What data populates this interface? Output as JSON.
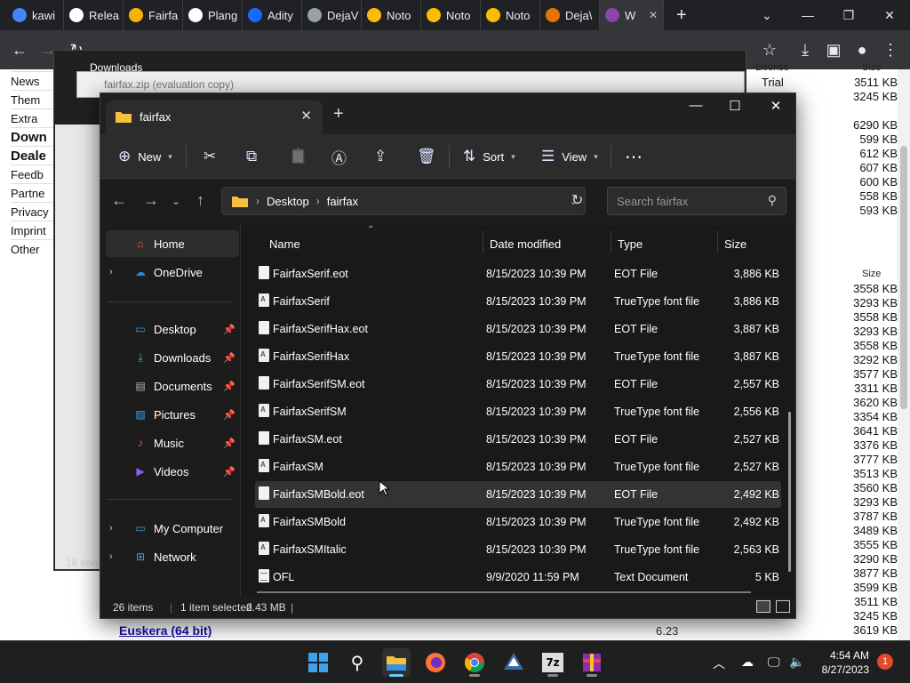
{
  "chrome": {
    "tabs": [
      {
        "label": "kawi",
        "icon": "google-icon",
        "color": "#4285f4"
      },
      {
        "label": "Relea",
        "icon": "github-icon",
        "color": "#ffffff"
      },
      {
        "label": "Fairfa",
        "icon": "font-site-icon",
        "color": "#f4b400"
      },
      {
        "label": "Plang",
        "icon": "github-icon",
        "color": "#ffffff"
      },
      {
        "label": "Adity",
        "icon": "behance-icon",
        "color": "#1769ff"
      },
      {
        "label": "DejaV",
        "icon": "globe-icon",
        "color": "#9aa0a6"
      },
      {
        "label": "Noto",
        "icon": "noto-icon",
        "color": "#fbbc04"
      },
      {
        "label": "Noto",
        "icon": "noto-icon",
        "color": "#fbbc04"
      },
      {
        "label": "Noto",
        "icon": "noto-icon",
        "color": "#fbbc04"
      },
      {
        "label": "Deja\\",
        "icon": "diamond-icon",
        "color": "#e37400"
      },
      {
        "label": "W",
        "icon": "winrar-icon",
        "color": "#8e44ad"
      }
    ]
  },
  "webpage": {
    "side_links": [
      {
        "label": "News",
        "bold": false
      },
      {
        "label": "Them",
        "bold": false
      },
      {
        "label": "Extra",
        "bold": false
      },
      {
        "label": "Down",
        "bold": true
      },
      {
        "label": "Deale",
        "bold": true
      },
      {
        "label": "Feedb",
        "bold": false
      },
      {
        "label": "Partne",
        "bold": false
      },
      {
        "label": "Privacy",
        "bold": false
      },
      {
        "label": "Imprint",
        "bold": false
      },
      {
        "label": "Other",
        "bold": false
      }
    ],
    "license_header": "License",
    "size_header": "Size",
    "top_rows": [
      {
        "license": "Trial",
        "size": "3511 KB"
      },
      {
        "license": "",
        "size": "3245 KB"
      },
      {
        "license": "",
        "size": "6290 KB"
      },
      {
        "license": "",
        "size": "599 KB"
      },
      {
        "license": "",
        "size": "612 KB"
      },
      {
        "license": "",
        "size": "607 KB"
      },
      {
        "license": "",
        "size": "600 KB"
      },
      {
        "license": "",
        "size": "558 KB"
      },
      {
        "license": "",
        "size": "593 KB"
      }
    ],
    "bottom_sizes": [
      "3558 KB",
      "3293 KB",
      "3558 KB",
      "3293 KB",
      "3558 KB",
      "3292 KB",
      "3577 KB",
      "3311 KB",
      "3620 KB",
      "3354 KB",
      "3641 KB",
      "3376 KB",
      "3777 KB",
      "3513 KB",
      "3560 KB",
      "3293 KB",
      "3787 KB",
      "3489 KB",
      "3555 KB",
      "3290 KB",
      "3877 KB",
      "3599 KB",
      "3511 KB",
      "3245 KB",
      "3619 KB"
    ],
    "lang_link": "Euskera (64 bit)",
    "lang_version": "6.23"
  },
  "bg_windows": {
    "downloads_title": "Downloads",
    "zip_title": "fairfax.zip (evaluation copy)",
    "items_count": "18 item"
  },
  "explorer": {
    "tab_title": "fairfax",
    "commands": {
      "new": "New",
      "sort": "Sort",
      "view": "View"
    },
    "breadcrumb": [
      "Desktop",
      "fairfax"
    ],
    "search_placeholder": "Search fairfax",
    "nav": [
      {
        "label": "Home",
        "icon": "home-icon",
        "color": "#e86b3a",
        "pinned": false,
        "expandable": false,
        "selected": true
      },
      {
        "label": "OneDrive",
        "icon": "onedrive-icon",
        "color": "#2b88d8",
        "pinned": false,
        "expandable": true,
        "selected": false
      },
      {
        "label": "Desktop",
        "icon": "desktop-icon",
        "color": "#3aa0e0",
        "pinned": true,
        "expandable": false,
        "selected": false
      },
      {
        "label": "Downloads",
        "icon": "downloads-icon",
        "color": "#3fc47a",
        "pinned": true,
        "expandable": false,
        "selected": false
      },
      {
        "label": "Documents",
        "icon": "documents-icon",
        "color": "#a8b4c8",
        "pinned": true,
        "expandable": false,
        "selected": false
      },
      {
        "label": "Pictures",
        "icon": "pictures-icon",
        "color": "#38a0f0",
        "pinned": true,
        "expandable": false,
        "selected": false
      },
      {
        "label": "Music",
        "icon": "music-icon",
        "color": "#e05a7a",
        "pinned": true,
        "expandable": false,
        "selected": false
      },
      {
        "label": "Videos",
        "icon": "videos-icon",
        "color": "#8a5cf0",
        "pinned": true,
        "expandable": false,
        "selected": false
      },
      {
        "label": "My Computer",
        "icon": "computer-icon",
        "color": "#3aa0e0",
        "pinned": false,
        "expandable": true,
        "selected": false
      },
      {
        "label": "Network",
        "icon": "network-icon",
        "color": "#3aa0e0",
        "pinned": false,
        "expandable": true,
        "selected": false
      }
    ],
    "columns": {
      "name": "Name",
      "date": "Date modified",
      "type": "Type",
      "size": "Size"
    },
    "files": [
      {
        "name": "FairfaxSerif.eot",
        "date": "8/15/2023 10:39 PM",
        "type": "EOT File",
        "size": "3,886 KB",
        "kind": "eot"
      },
      {
        "name": "FairfaxSerif",
        "date": "8/15/2023 10:39 PM",
        "type": "TrueType font file",
        "size": "3,886 KB",
        "kind": "ttf"
      },
      {
        "name": "FairfaxSerifHax.eot",
        "date": "8/15/2023 10:39 PM",
        "type": "EOT File",
        "size": "3,887 KB",
        "kind": "eot"
      },
      {
        "name": "FairfaxSerifHax",
        "date": "8/15/2023 10:39 PM",
        "type": "TrueType font file",
        "size": "3,887 KB",
        "kind": "ttf"
      },
      {
        "name": "FairfaxSerifSM.eot",
        "date": "8/15/2023 10:39 PM",
        "type": "EOT File",
        "size": "2,557 KB",
        "kind": "eot"
      },
      {
        "name": "FairfaxSerifSM",
        "date": "8/15/2023 10:39 PM",
        "type": "TrueType font file",
        "size": "2,556 KB",
        "kind": "ttf"
      },
      {
        "name": "FairfaxSM.eot",
        "date": "8/15/2023 10:39 PM",
        "type": "EOT File",
        "size": "2,527 KB",
        "kind": "eot"
      },
      {
        "name": "FairfaxSM",
        "date": "8/15/2023 10:39 PM",
        "type": "TrueType font file",
        "size": "2,527 KB",
        "kind": "ttf"
      },
      {
        "name": "FairfaxSMBold.eot",
        "date": "8/15/2023 10:39 PM",
        "type": "EOT File",
        "size": "2,492 KB",
        "kind": "eot",
        "selected": true
      },
      {
        "name": "FairfaxSMBold",
        "date": "8/15/2023 10:39 PM",
        "type": "TrueType font file",
        "size": "2,492 KB",
        "kind": "ttf"
      },
      {
        "name": "FairfaxSMItalic",
        "date": "8/15/2023 10:39 PM",
        "type": "TrueType font file",
        "size": "2,563 KB",
        "kind": "ttf"
      },
      {
        "name": "OFL",
        "date": "9/9/2020 11:59 PM",
        "type": "Text Document",
        "size": "5 KB",
        "kind": "txt"
      }
    ],
    "status": {
      "items": "26 items",
      "selected": "1 item selected",
      "size": "2.43 MB"
    }
  },
  "taskbar": {
    "apps": [
      {
        "name": "start-icon",
        "active": false
      },
      {
        "name": "search-icon",
        "active": false
      },
      {
        "name": "file-explorer-icon",
        "active": true
      },
      {
        "name": "firefox-icon",
        "active": false
      },
      {
        "name": "chrome-icon",
        "active": false
      },
      {
        "name": "inkscape-icon",
        "active": false
      },
      {
        "name": "7zip-icon",
        "active": false
      },
      {
        "name": "winrar-icon",
        "active": false
      }
    ],
    "time": "4:54 AM",
    "date": "8/27/2023",
    "notifications": "1"
  }
}
